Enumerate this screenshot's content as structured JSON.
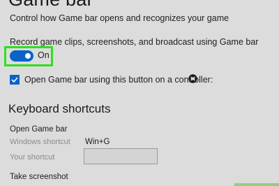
{
  "page": {
    "title": "Game bar",
    "description": "Control how Game bar opens and recognizes your game"
  },
  "record": {
    "label": "Record game clips, screenshots, and broadcast using Game bar",
    "toggle_state": "On",
    "toggle_on": true
  },
  "controller": {
    "label": "Open Game bar using this button on a controller:",
    "checked": true,
    "icon": "xbox-icon"
  },
  "keyboard_shortcuts": {
    "heading": "Keyboard shortcuts",
    "open_game_bar": {
      "title": "Open Game bar",
      "windows_shortcut_label": "Windows shortcut",
      "windows_shortcut_value": "Win+G",
      "your_shortcut_label": "Your shortcut",
      "your_shortcut_value": ""
    },
    "take_screenshot": {
      "title": "Take screenshot"
    }
  },
  "colors": {
    "background": "#dcdcdc",
    "accent": "#0a64c8",
    "highlight": "#2ee01e",
    "muted_text": "#8a8a8a"
  }
}
